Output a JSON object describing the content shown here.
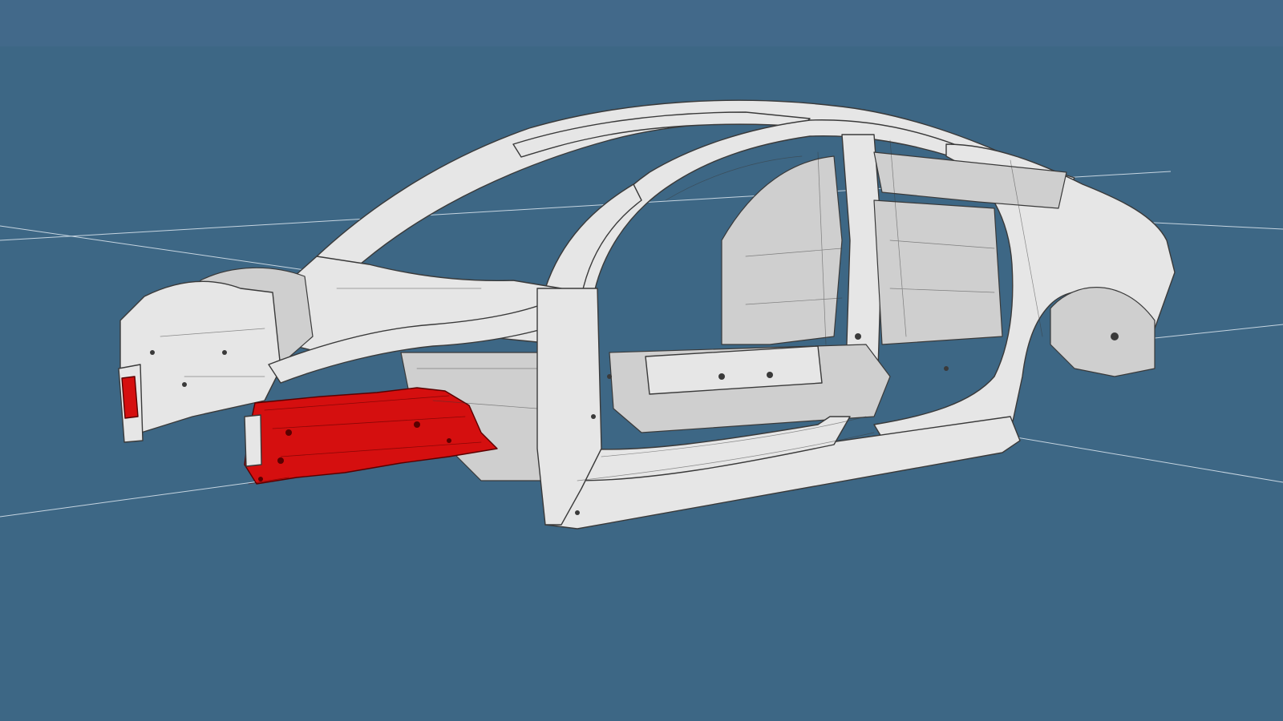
{
  "viewport": {
    "background_color": "#3d6785",
    "top_band_color": "#42698a",
    "grid_line_color": "#c5d4e0"
  },
  "model": {
    "body_fill": "#e6e6e6",
    "body_shade": "#cfcfcf",
    "edge_color": "#3a3a3a",
    "highlight_color": "#d50f0f",
    "highlight_edge_color": "#5a0000",
    "selected_parts": [
      "front-left-frame-rail",
      "front-left-crash-tip"
    ]
  }
}
